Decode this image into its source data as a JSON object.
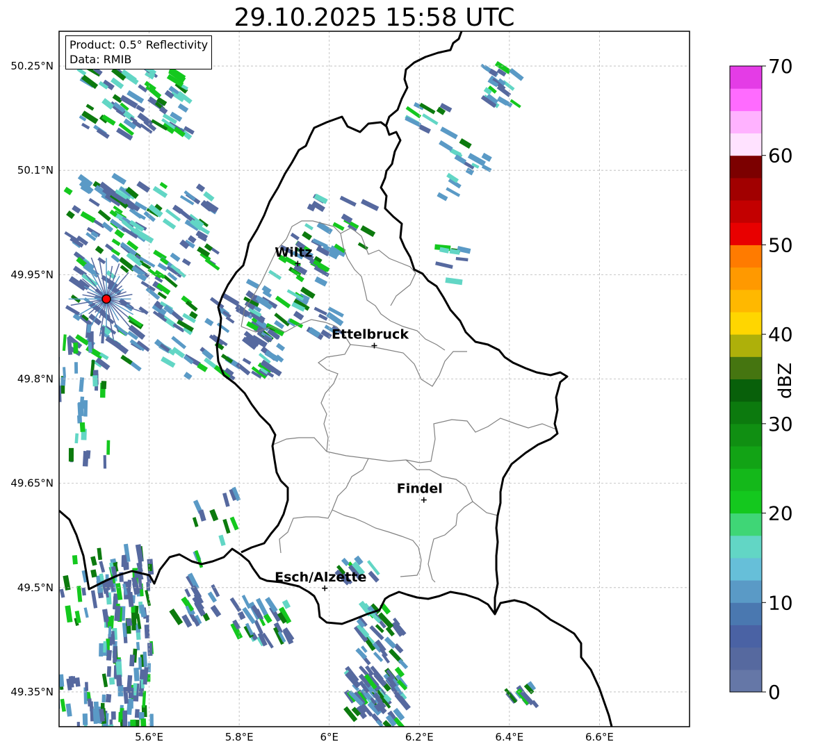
{
  "title": "29.10.2025 15:58 UTC",
  "info": {
    "product": "Product: 0.5° Reflectivity",
    "data": "Data: RMIB"
  },
  "cities": [
    {
      "name": "Wiltz",
      "lon": 5.93,
      "lat": 49.966
    },
    {
      "name": "Ettelbruck",
      "lon": 6.1,
      "lat": 49.848
    },
    {
      "name": "Findel",
      "lon": 6.21,
      "lat": 49.626
    },
    {
      "name": "Esch/Alzette",
      "lon": 5.99,
      "lat": 49.499
    }
  ],
  "radar_site": {
    "lon": 5.505,
    "lat": 49.915,
    "color": "#ff0000"
  },
  "axes": {
    "lon_range": [
      5.4,
      6.8
    ],
    "lat_range": [
      49.3,
      50.3
    ],
    "lon_ticks": [
      {
        "value": 5.6,
        "label": "5.6°E"
      },
      {
        "value": 5.8,
        "label": "5.8°E"
      },
      {
        "value": 6.0,
        "label": "6°E"
      },
      {
        "value": 6.2,
        "label": "6.2°E"
      },
      {
        "value": 6.4,
        "label": "6.4°E"
      },
      {
        "value": 6.6,
        "label": "6.6°E"
      }
    ],
    "lat_ticks": [
      {
        "value": 50.25,
        "label": "50.25°N"
      },
      {
        "value": 50.1,
        "label": "50.1°N"
      },
      {
        "value": 49.95,
        "label": "49.95°N"
      },
      {
        "value": 49.8,
        "label": "49.8°N"
      },
      {
        "value": 49.65,
        "label": "49.65°N"
      },
      {
        "value": 49.5,
        "label": "49.5°N"
      },
      {
        "value": 49.35,
        "label": "49.35°N"
      }
    ],
    "grid": true
  },
  "colorbar": {
    "label": "dBZ",
    "min": 0,
    "max": 70,
    "ticks": [
      "0",
      "10",
      "20",
      "30",
      "40",
      "50",
      "60",
      "70"
    ],
    "colors": [
      "#6577a7",
      "#56699f",
      "#4a62a4",
      "#4a78b0",
      "#5a9ac6",
      "#66bfd9",
      "#62d6c5",
      "#3fd676",
      "#14c81e",
      "#14b81a",
      "#12a315",
      "#108f12",
      "#0c7a0e",
      "#08600a",
      "#457510",
      "#aeb00a",
      "#ffd600",
      "#ffb800",
      "#ff9900",
      "#ff7b00",
      "#e80000",
      "#c30000",
      "#a10000",
      "#7c0000",
      "#ffe2ff",
      "#ffb2ff",
      "#ff6bff",
      "#e43ce6"
    ]
  },
  "echo_colors": {
    "light": "#56699f",
    "medium": "#5a9ac6",
    "cyan": "#62d6c5",
    "green": "#14c81e",
    "dark_green": "#0c7a0e"
  }
}
